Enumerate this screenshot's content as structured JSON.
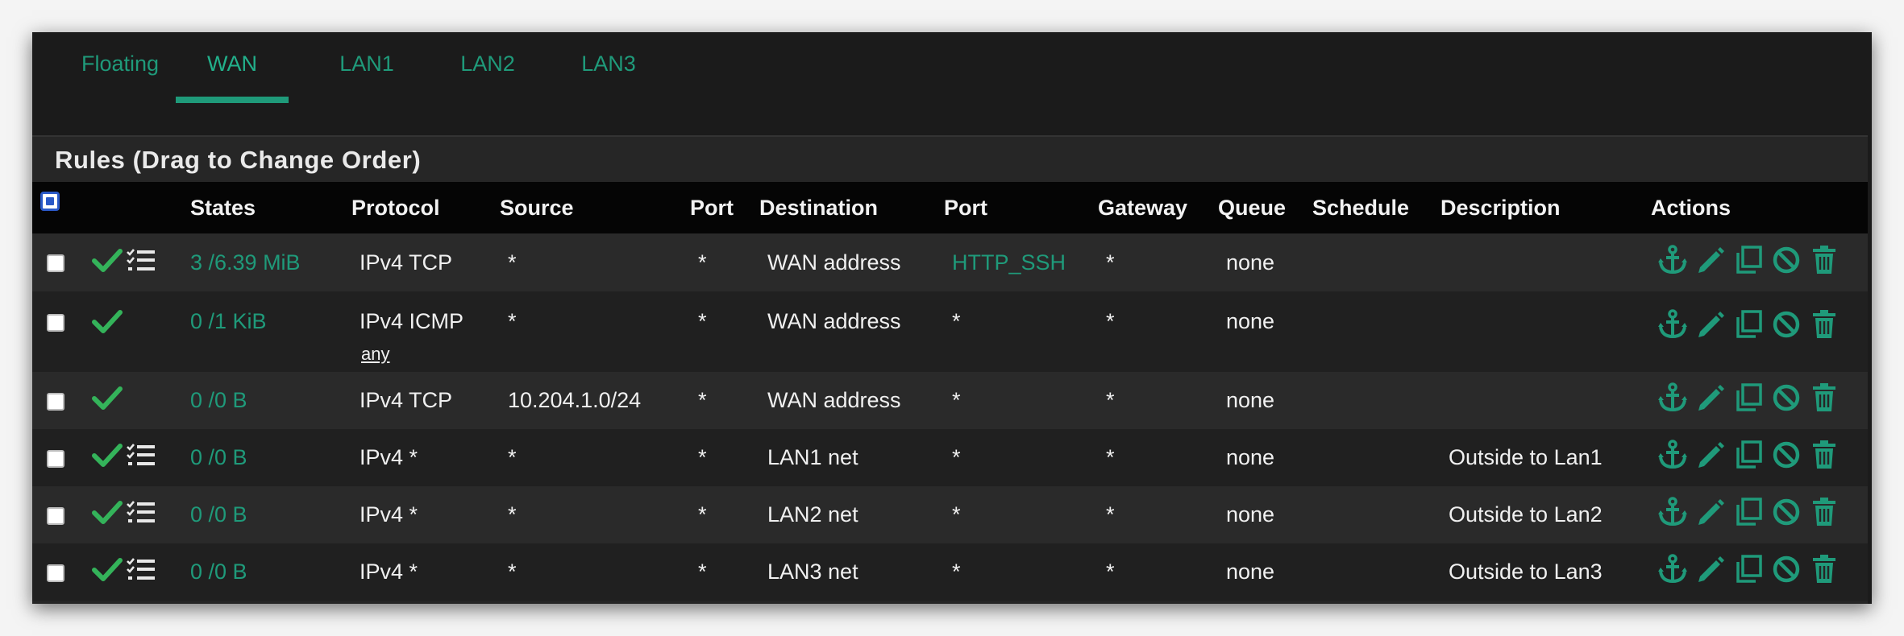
{
  "tabs": [
    {
      "label": "Floating",
      "active": false
    },
    {
      "label": "WAN",
      "active": true
    },
    {
      "label": "LAN1",
      "active": false
    },
    {
      "label": "LAN2",
      "active": false
    },
    {
      "label": "LAN3",
      "active": false
    }
  ],
  "panel": {
    "title": "Rules (Drag to Change Order)"
  },
  "columns": {
    "states": "States",
    "protocol": "Protocol",
    "source": "Source",
    "port": "Port",
    "destination": "Destination",
    "dest_port": "Port",
    "gateway": "Gateway",
    "queue": "Queue",
    "schedule": "Schedule",
    "description": "Description",
    "actions": "Actions"
  },
  "rows": [
    {
      "states": "3 /6.39 MiB",
      "protocol": "IPv4 TCP",
      "protocol_sub": "",
      "source": "*",
      "port": "*",
      "destination": "WAN address",
      "dest_port": "HTTP_SSH",
      "gateway": "*",
      "queue": "none",
      "schedule": "",
      "description": "",
      "icons": [
        "check-icon",
        "list-icon"
      ]
    },
    {
      "states": "0 /1 KiB",
      "protocol": "IPv4 ICMP",
      "protocol_sub": "any",
      "source": "*",
      "port": "*",
      "destination": "WAN address",
      "dest_port": "*",
      "gateway": "*",
      "queue": "none",
      "schedule": "",
      "description": "",
      "icons": [
        "check-icon"
      ]
    },
    {
      "states": "0 /0 B",
      "protocol": "IPv4 TCP",
      "protocol_sub": "",
      "source": "10.204.1.0/24",
      "port": "*",
      "destination": "WAN address",
      "dest_port": "*",
      "gateway": "*",
      "queue": "none",
      "schedule": "",
      "description": "",
      "icons": [
        "check-icon"
      ]
    },
    {
      "states": "0 /0 B",
      "protocol": "IPv4 *",
      "protocol_sub": "",
      "source": "*",
      "port": "*",
      "destination": "LAN1 net",
      "dest_port": "*",
      "gateway": "*",
      "queue": "none",
      "schedule": "",
      "description": "Outside to Lan1",
      "icons": [
        "check-icon",
        "list-icon"
      ]
    },
    {
      "states": "0 /0 B",
      "protocol": "IPv4 *",
      "protocol_sub": "",
      "source": "*",
      "port": "*",
      "destination": "LAN2 net",
      "dest_port": "*",
      "gateway": "*",
      "queue": "none",
      "schedule": "",
      "description": "Outside to Lan2",
      "icons": [
        "check-icon",
        "list-icon"
      ]
    },
    {
      "states": "0 /0 B",
      "protocol": "IPv4 *",
      "protocol_sub": "",
      "source": "*",
      "port": "*",
      "destination": "LAN3 net",
      "dest_port": "*",
      "gateway": "*",
      "queue": "none",
      "schedule": "",
      "description": "Outside to Lan3",
      "icons": [
        "check-icon",
        "list-icon"
      ]
    }
  ],
  "action_icons": [
    "anchor-icon",
    "pencil-icon",
    "copy-icon",
    "disable-icon",
    "trash-icon"
  ],
  "colors": {
    "accent": "#1f9a7a",
    "check": "#34b35a",
    "background": "#1b1b1b",
    "header": "#050505"
  }
}
